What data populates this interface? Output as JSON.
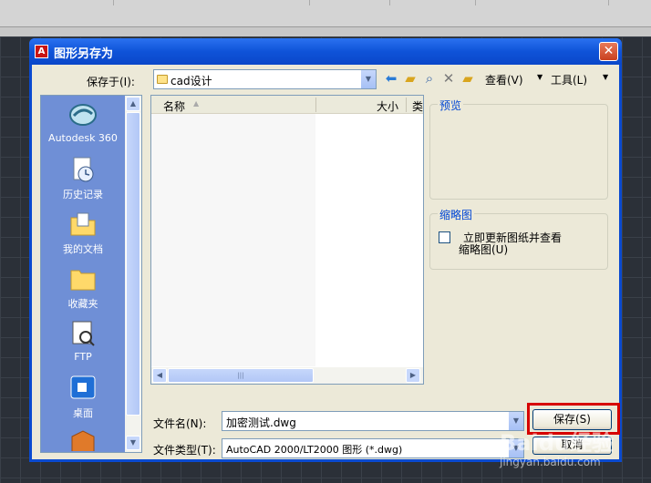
{
  "window": {
    "title": "图形另存为",
    "close": "✕"
  },
  "save_in": {
    "label": "保存于(I):",
    "value": "cad设计"
  },
  "toolbar": {
    "view_label": "查看(V)",
    "tools_label": "工具(L)"
  },
  "places": [
    {
      "label": "Autodesk 360",
      "icon": "autodesk-360-icon"
    },
    {
      "label": "历史记录",
      "icon": "history-icon"
    },
    {
      "label": "我的文档",
      "icon": "my-documents-icon"
    },
    {
      "label": "收藏夹",
      "icon": "favorites-folder-icon"
    },
    {
      "label": "FTP",
      "icon": "ftp-icon"
    },
    {
      "label": "桌面",
      "icon": "desktop-icon"
    }
  ],
  "file_list": {
    "columns": [
      "名称",
      "大小",
      "类"
    ]
  },
  "preview": {
    "title": "预览"
  },
  "thumbnail": {
    "title": "缩略图",
    "checkbox_line1": "立即更新图纸并查看",
    "checkbox_line2": "缩略图(U)"
  },
  "filename": {
    "label": "文件名(N):",
    "value": "加密测试.dwg"
  },
  "filetype": {
    "label": "文件类型(T):",
    "value": "AutoCAD 2000/LT2000 图形 (*.dwg)"
  },
  "buttons": {
    "save": "保存(S)",
    "cancel": "取消"
  },
  "watermark": {
    "text": "Baidu经验",
    "url": "jingyan.baidu.com"
  },
  "colors": {
    "titlebar": "#0f53d8",
    "places_bg": "#6f8fd6",
    "highlight": "#d60000"
  }
}
